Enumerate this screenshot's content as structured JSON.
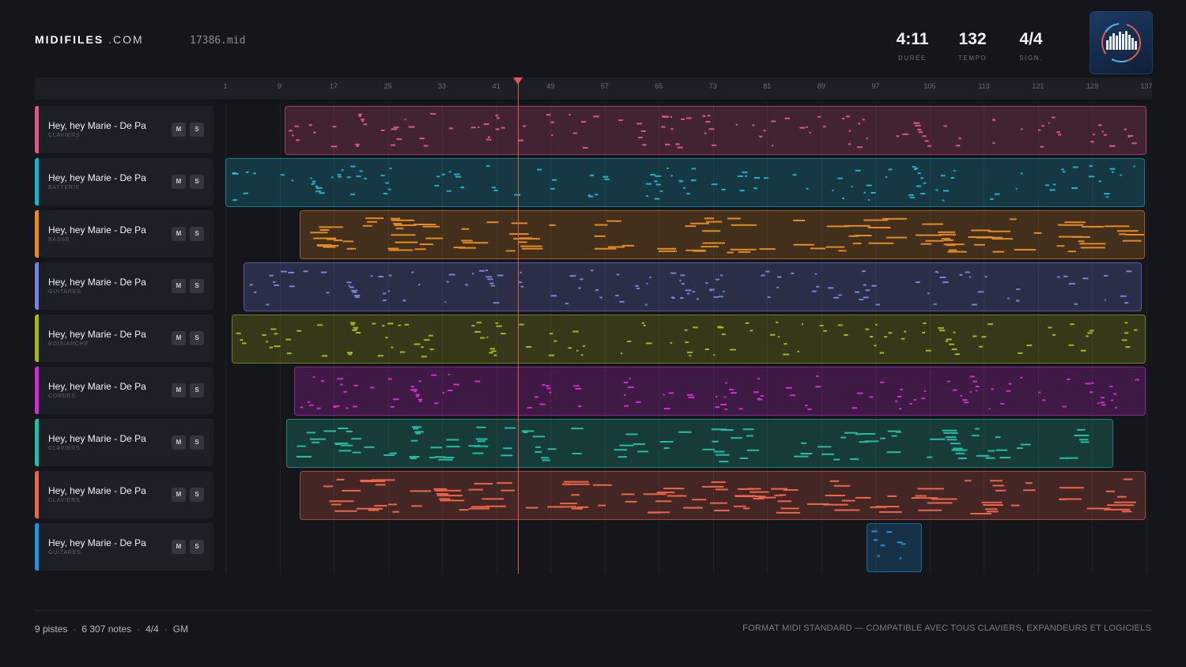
{
  "header": {
    "brand_bold": "MIDIFILES",
    "brand_light": ".COM",
    "filename": "17386.mid",
    "stats": [
      {
        "value": "4:11",
        "label": "DURÉE"
      },
      {
        "value": "132",
        "label": "TEMPO"
      },
      {
        "value": "4/4",
        "label": "SIGN."
      }
    ]
  },
  "ruler": {
    "ticks": [
      "1",
      "9",
      "17",
      "25",
      "33",
      "41",
      "49",
      "57",
      "65",
      "73",
      "81",
      "89",
      "97",
      "105",
      "113",
      "121",
      "129",
      "137"
    ]
  },
  "tracks": [
    {
      "name": "Hey, hey Marie - De Pa",
      "category": "CLAVIERS",
      "color": "#e2538a",
      "mute": "M",
      "solo": "S"
    },
    {
      "name": "Hey, hey Marie - De Pa",
      "category": "BATTERIE",
      "color": "#17b3cf",
      "mute": "M",
      "solo": "S"
    },
    {
      "name": "Hey, hey Marie - De Pa",
      "category": "BASSE",
      "color": "#e58a1f",
      "mute": "M",
      "solo": "S"
    },
    {
      "name": "Hey, hey Marie - De Pa",
      "category": "GUITARES",
      "color": "#7583e0",
      "mute": "M",
      "solo": "S"
    },
    {
      "name": "Hey, hey Marie - De Pa",
      "category": "BOIS/ANCHE",
      "color": "#a7b619",
      "mute": "M",
      "solo": "S"
    },
    {
      "name": "Hey, hey Marie - De Pa",
      "category": "CORDES",
      "color": "#d42bd4",
      "mute": "M",
      "solo": "S"
    },
    {
      "name": "Hey, hey Marie - De Pa",
      "category": "CLAVIERS",
      "color": "#1fbfa6",
      "mute": "M",
      "solo": "S"
    },
    {
      "name": "Hey, hey Marie - De Pa",
      "category": "CLAVIERS",
      "color": "#ee6449",
      "mute": "M",
      "solo": "S"
    },
    {
      "name": "Hey, hey Marie - De Pa",
      "category": "GUITARES",
      "color": "#1f95e0",
      "mute": "M",
      "solo": "S"
    }
  ],
  "footer": {
    "tracks_count": "9 pistes",
    "notes_count": "6 307 notes",
    "signature": "4/4",
    "standard": "GM",
    "tagline": "FORMAT MIDI STANDARD — COMPATIBLE AVEC TOUS CLAVIERS, EXPANDEURS ET LOGICIELS"
  }
}
